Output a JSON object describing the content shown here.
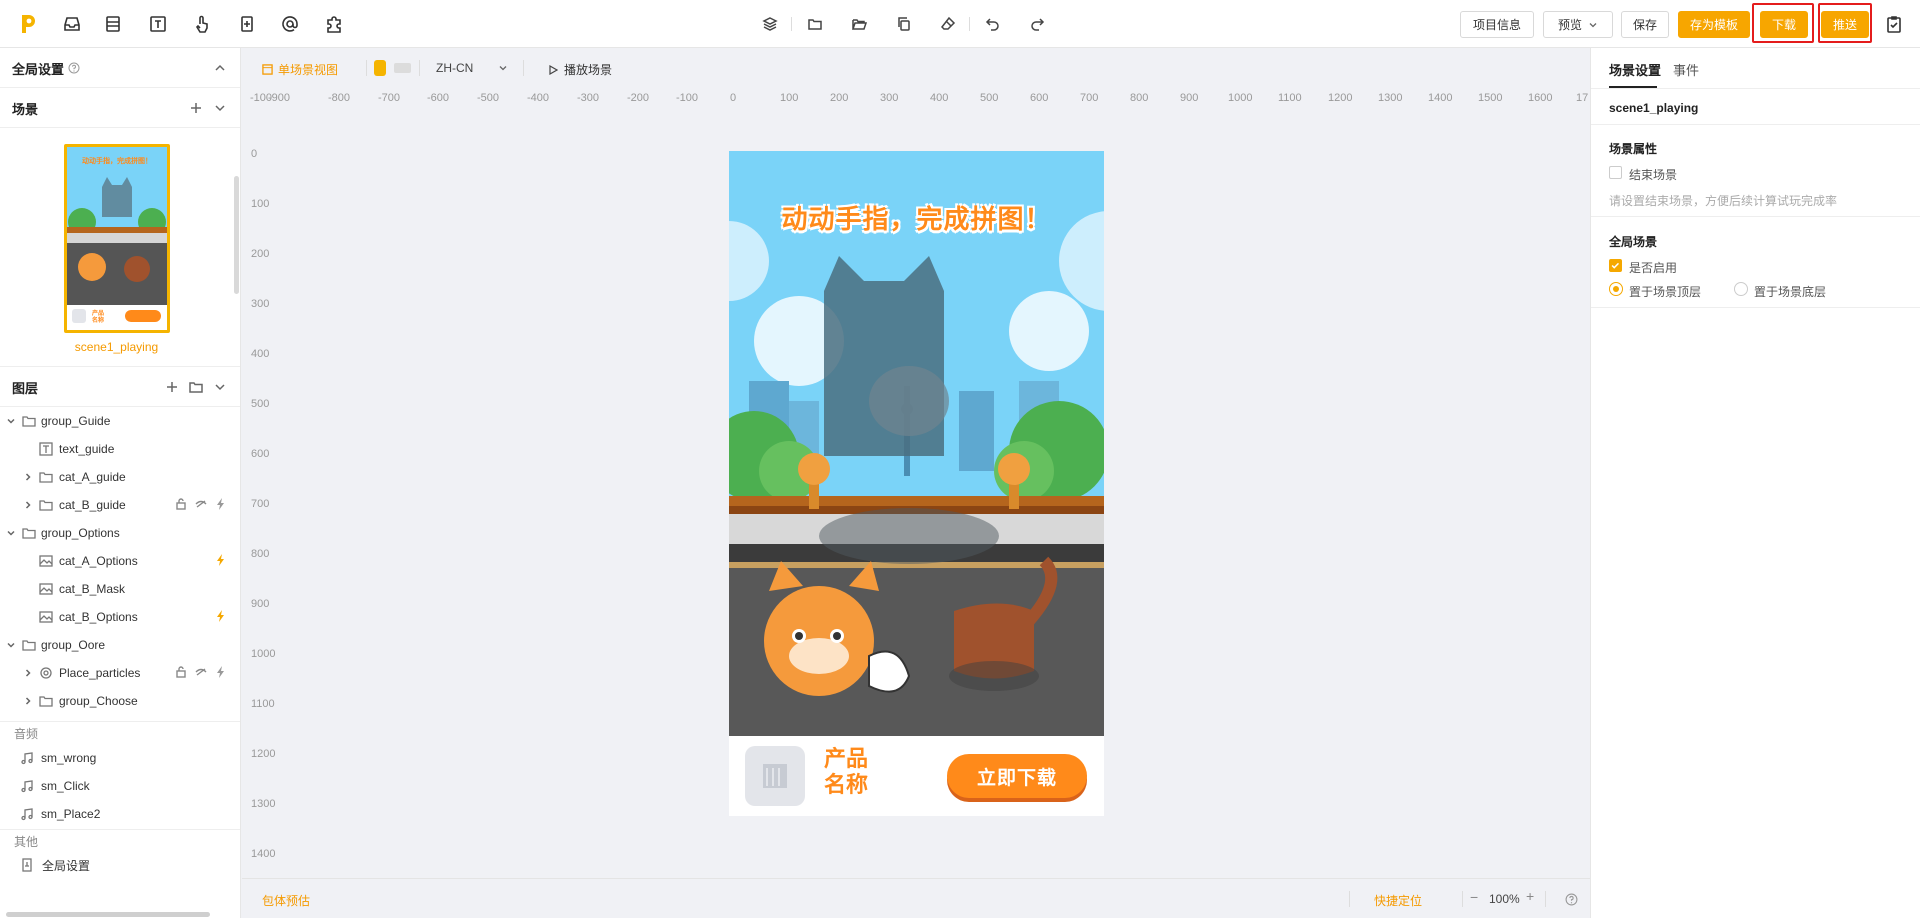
{
  "toolbar": {
    "project_info": "项目信息",
    "preview": "预览",
    "save": "保存",
    "save_template": "存为模板",
    "download": "下载",
    "push": "推送"
  },
  "left_panel": {
    "global_settings": "全局设置",
    "scenes_title": "场景",
    "scene_name": "scene1_playing",
    "layers_title": "图层",
    "layers": [
      {
        "label": "group_Guide"
      },
      {
        "label": "text_guide"
      },
      {
        "label": "cat_A_guide"
      },
      {
        "label": "cat_B_guide"
      },
      {
        "label": "group_Options"
      },
      {
        "label": "cat_A_Options"
      },
      {
        "label": "cat_B_Mask"
      },
      {
        "label": "cat_B_Options"
      },
      {
        "label": "group_Oore"
      },
      {
        "label": "Place_particles"
      },
      {
        "label": "group_Choose"
      }
    ],
    "audio_title": "音频",
    "audio": [
      "sm_wrong",
      "sm_Click",
      "sm_Place2"
    ],
    "other_title": "其他",
    "other_item": "全局设置"
  },
  "canvas_bar": {
    "single_view": "单场景视图",
    "language": "ZH-CN",
    "play_scene": "播放场景"
  },
  "ruler": {
    "h": [
      "-100",
      "-900",
      "-800",
      "-700",
      "-600",
      "-500",
      "-400",
      "-300",
      "-200",
      "-100",
      "0",
      "100",
      "200",
      "300",
      "400",
      "500",
      "600",
      "700",
      "800",
      "900",
      "1000",
      "1100",
      "1200",
      "1300",
      "1400",
      "1500",
      "1600",
      "17"
    ],
    "v": [
      "0",
      "100",
      "200",
      "300",
      "400",
      "500",
      "600",
      "700",
      "800",
      "900",
      "1000",
      "1100",
      "1200",
      "1300",
      "1400"
    ]
  },
  "phone": {
    "title": "动动手指，完成拼图！",
    "product_name": "产品名称",
    "download_btn": "立即下载"
  },
  "bottom_bar": {
    "package_estimate": "包体预估",
    "quick_locate": "快捷定位",
    "zoom": "100%"
  },
  "right_panel": {
    "tab_scene": "场景设置",
    "tab_event": "事件",
    "scene_name": "scene1_playing",
    "scene_props": "场景属性",
    "end_scene": "结束场景",
    "end_scene_hint": "请设置结束场景，方便后续计算试玩完成率",
    "global_scene": "全局场景",
    "enabled": "是否启用",
    "top_layer": "置于场景顶层",
    "bottom_layer": "置于场景底层"
  },
  "colors": {
    "accent": "#f7a600",
    "highlight": "#e41c1c"
  }
}
